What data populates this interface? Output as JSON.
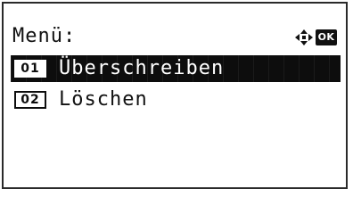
{
  "screen": {
    "title": "Menü:",
    "ok_label": "OK",
    "nav_icon": "four-way-arrow-icon"
  },
  "menu": {
    "items": [
      {
        "number": "01",
        "label": "Überschreiben",
        "selected": true
      },
      {
        "number": "02",
        "label": "Löschen",
        "selected": false
      }
    ]
  },
  "colors": {
    "background": "#ffffff",
    "text": "#111111",
    "highlight": "#0d0d0d",
    "highlight_text": "#ffffff"
  }
}
